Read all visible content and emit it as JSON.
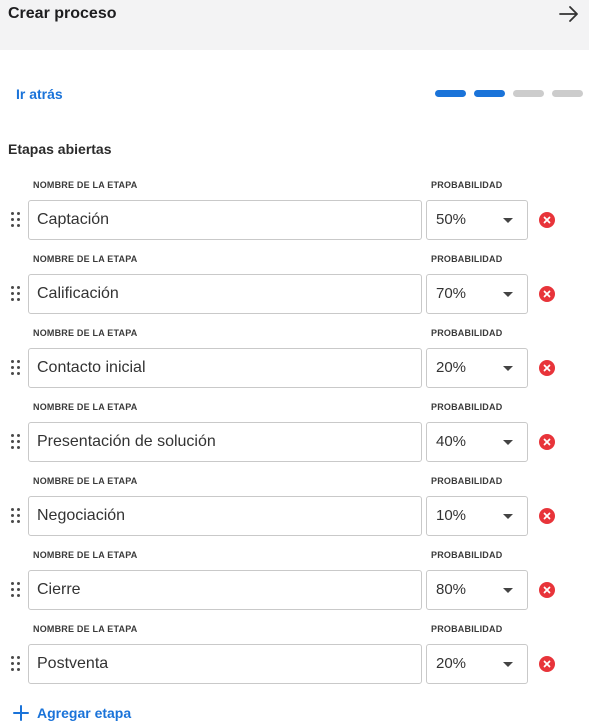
{
  "header": {
    "title": "Crear proceso",
    "next_icon": "arrow-right-icon"
  },
  "nav": {
    "back_label": "Ir atrás"
  },
  "progress": {
    "total_steps": 4,
    "current_step": 2,
    "active_color": "#1a73d9",
    "inactive_color": "#cccccc"
  },
  "section": {
    "title": "Etapas abiertas"
  },
  "columns": {
    "name_label": "NOMBRE DE LA ETAPA",
    "probability_label": "PROBABILIDAD"
  },
  "stages": [
    {
      "name": "Captación",
      "probability": "50%"
    },
    {
      "name": "Calificación",
      "probability": "70%"
    },
    {
      "name": "Contacto inicial",
      "probability": "20%"
    },
    {
      "name": "Presentación de solución",
      "probability": "40%"
    },
    {
      "name": "Negociación",
      "probability": "10%"
    },
    {
      "name": "Cierre",
      "probability": "80%"
    },
    {
      "name": "Postventa",
      "probability": "20%"
    }
  ],
  "add_stage": {
    "label": "Agregar etapa",
    "icon": "plus-icon"
  },
  "colors": {
    "accent": "#1a73d9",
    "remove": "#e8343a",
    "header_bg": "#f3f3f4"
  }
}
